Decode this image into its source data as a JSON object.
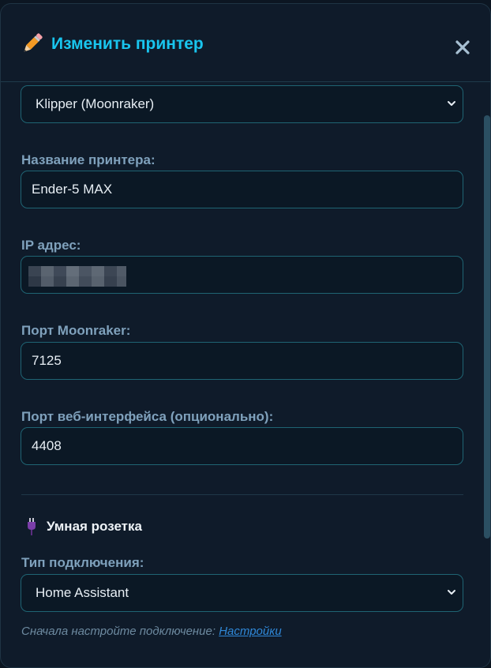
{
  "modal": {
    "title": "Изменить принтер",
    "title_icon": "pencil-icon",
    "close_label": "✕"
  },
  "form": {
    "printer_type": {
      "selected": "Klipper (Moonraker)"
    },
    "printer_name": {
      "label": "Название принтера:",
      "value": "Ender-5 MAX"
    },
    "ip_address": {
      "label": "IP адрес:",
      "value": "[redacted]"
    },
    "moonraker_port": {
      "label": "Порт Moonraker:",
      "value": "7125"
    },
    "web_port": {
      "label": "Порт веб-интерфейса (опционально):",
      "value": "4408"
    },
    "smart_plug": {
      "icon": "plug-icon",
      "title": "Умная розетка",
      "connection_type_label": "Тип подключения:",
      "connection_type_selected": "Home Assistant",
      "hint_text": "Сначала настройте подключение: ",
      "hint_link": "Настройки"
    }
  },
  "colors": {
    "accent_title": "#19c5ee",
    "label": "#7fa1bc",
    "field_border": "#1f6473",
    "link": "#2f88d8",
    "background": "#0f1b2a"
  }
}
